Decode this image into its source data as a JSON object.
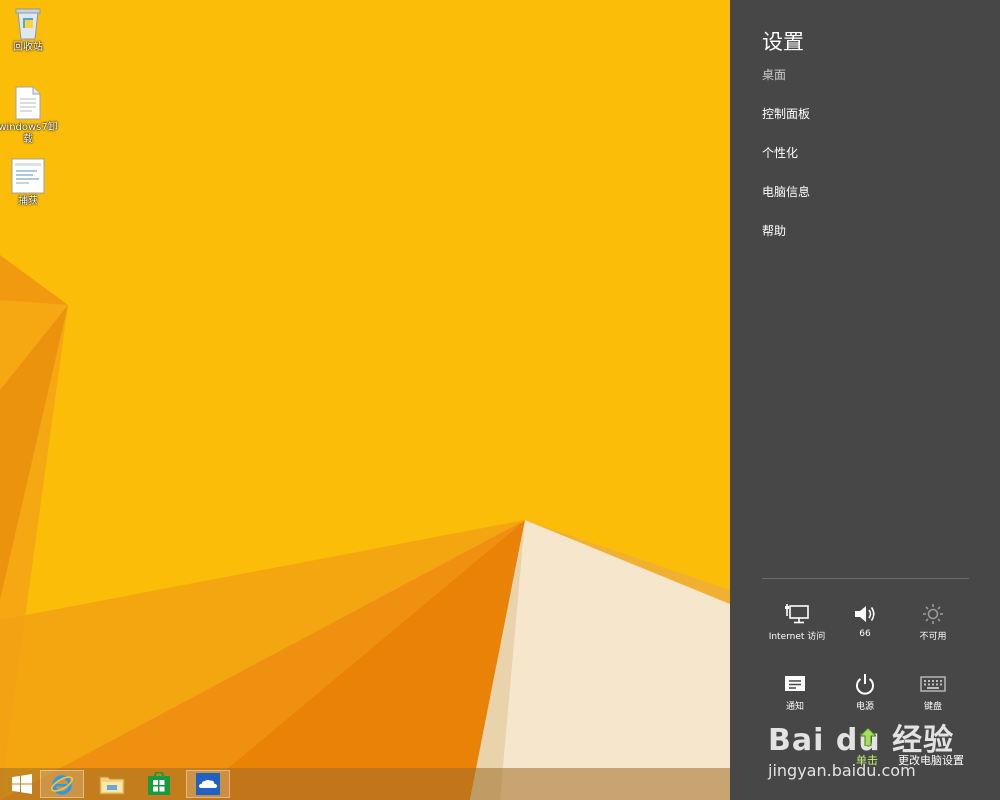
{
  "desktop": {
    "icons": [
      {
        "label": "回收站",
        "icon": "recycle-bin-icon"
      },
      {
        "label": "windows7卸载",
        "icon": "text-file-icon"
      },
      {
        "label": "捕获",
        "icon": "image-file-icon"
      }
    ]
  },
  "taskbar": {
    "items": [
      {
        "name": "start",
        "icon": "windows-logo-icon"
      },
      {
        "name": "internet-explorer",
        "icon": "ie-icon"
      },
      {
        "name": "file-explorer",
        "icon": "folder-icon"
      },
      {
        "name": "store",
        "icon": "store-icon"
      },
      {
        "name": "onedrive",
        "icon": "cloud-icon"
      }
    ]
  },
  "settings": {
    "title": "设置",
    "context": "桌面",
    "links": [
      "控制面板",
      "个性化",
      "电脑信息",
      "帮助"
    ],
    "quick": {
      "network": "Internet 访问",
      "volume": "66",
      "brightness": "不可用",
      "notifications": "通知",
      "power": "电源",
      "keyboard": "键盘"
    },
    "change_pc_settings": "更改电脑设置",
    "click_hint": "单击"
  },
  "watermark": {
    "main": "Bai du 经验",
    "url": "jingyan.baidu.com"
  },
  "colors": {
    "wallpaper": "#fbbd08",
    "pane": "#474747"
  }
}
